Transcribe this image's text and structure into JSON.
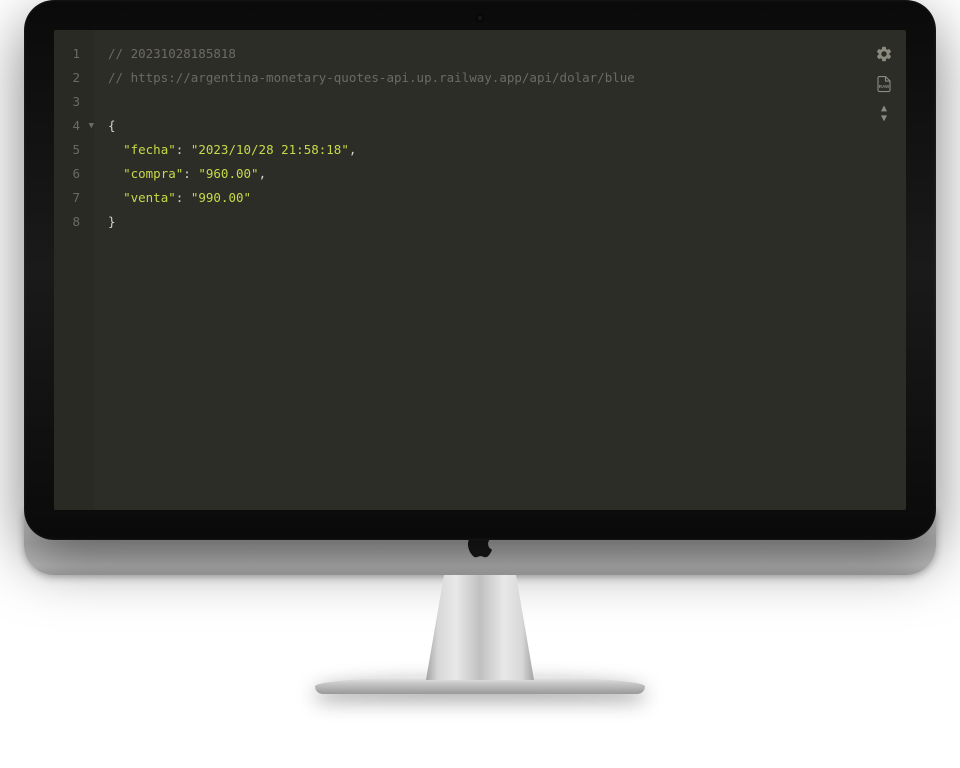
{
  "editor": {
    "line_numbers": [
      "1",
      "2",
      "3",
      "4",
      "5",
      "6",
      "7",
      "8"
    ],
    "comment_timestamp": "// 20231028185818",
    "comment_url": "// https://argentina-monetary-quotes-api.up.railway.app/api/dolar/blue",
    "json_body": {
      "open_brace": "{",
      "close_brace": "}",
      "fields": [
        {
          "key": "\"fecha\"",
          "value": "\"2023/10/28 21:58:18\"",
          "comma": ","
        },
        {
          "key": "\"compra\"",
          "value": "\"960.00\"",
          "comma": ","
        },
        {
          "key": "\"venta\"",
          "value": "\"990.00\"",
          "comma": ""
        }
      ]
    }
  },
  "toolbar": {
    "settings_title": "Settings",
    "raw_title": "Raw",
    "raw_badge": "RAW"
  }
}
